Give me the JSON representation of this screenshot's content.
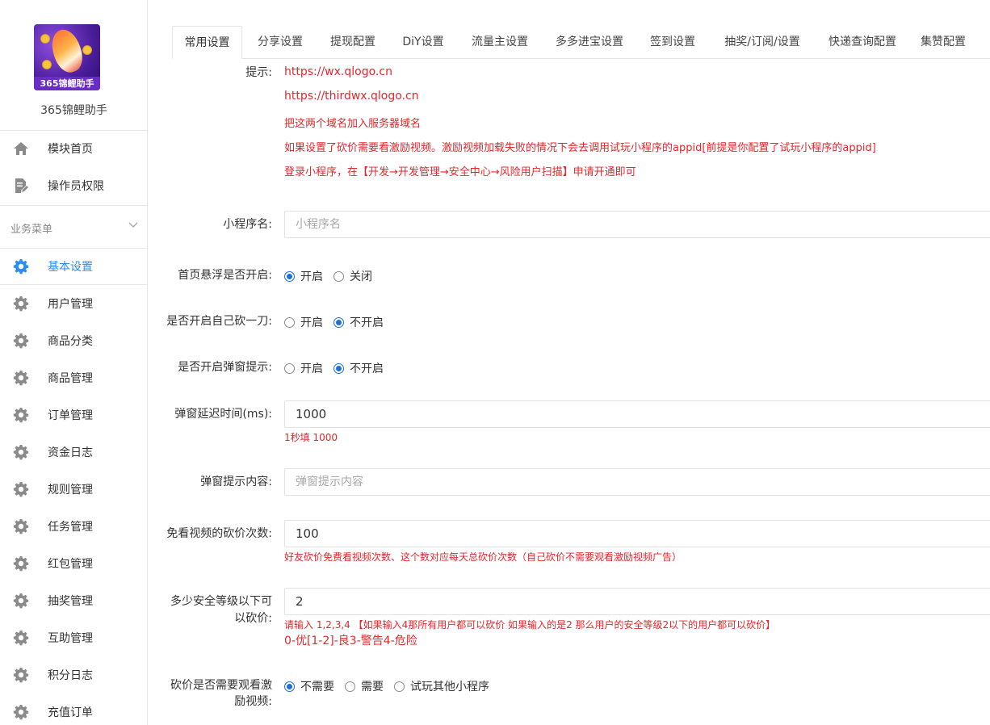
{
  "app": {
    "name": "365锦鲤助手",
    "logo_text": "365锦鲤助手"
  },
  "sidebar": {
    "top_items": [
      {
        "label": "模块首页",
        "icon": "home-icon"
      },
      {
        "label": "操作员权限",
        "icon": "document-edit-icon"
      }
    ],
    "section_title": "业务菜单",
    "items": [
      {
        "label": "基本设置",
        "icon": "gear-icon",
        "active": true
      },
      {
        "label": "用户管理",
        "icon": "gear-icon"
      },
      {
        "label": "商品分类",
        "icon": "gear-icon"
      },
      {
        "label": "商品管理",
        "icon": "gear-icon"
      },
      {
        "label": "订单管理",
        "icon": "gear-icon"
      },
      {
        "label": "资金日志",
        "icon": "gear-icon"
      },
      {
        "label": "规则管理",
        "icon": "gear-icon"
      },
      {
        "label": "任务管理",
        "icon": "gear-icon"
      },
      {
        "label": "红包管理",
        "icon": "gear-icon"
      },
      {
        "label": "抽奖管理",
        "icon": "gear-icon"
      },
      {
        "label": "互助管理",
        "icon": "gear-icon"
      },
      {
        "label": "积分日志",
        "icon": "gear-icon"
      },
      {
        "label": "充值订单",
        "icon": "gear-icon"
      }
    ]
  },
  "tabs": [
    "常用设置",
    "分享设置",
    "提现配置",
    "DiY设置",
    "流量主设置",
    "多多进宝设置",
    "签到设置",
    "抽奖/订阅/设置",
    "快递查询配置",
    "集赞配置"
  ],
  "form": {
    "tips_label": "提示:",
    "tips": [
      "https://wx.qlogo.cn",
      "https://thirdwx.qlogo.cn",
      "把这两个域名加入服务器域名",
      "如果设置了砍价需要看激励视频。激励视频加载失败的情况下会去调用试玩小程序的appid[前提是你配置了试玩小程序的appid]",
      "登录小程序，在【开发→开发管理→安全中心→风险用户扫描】申请开通即可"
    ],
    "mini_name": {
      "label": "小程序名:",
      "placeholder": "小程序名"
    },
    "float": {
      "label": "首页悬浮是否开启:",
      "opt_on": "开启",
      "opt_off": "关闭",
      "selected": "开启"
    },
    "self_cut": {
      "label": "是否开启自己砍一刀:",
      "opt_on": "开启",
      "opt_off": "不开启",
      "selected": "不开启"
    },
    "popup": {
      "label": "是否开启弹窗提示:",
      "opt_on": "开启",
      "opt_off": "不开启",
      "selected": "不开启"
    },
    "delay": {
      "label": "弹窗延迟时间(ms):",
      "value": "1000",
      "hint": "1秒填 1000"
    },
    "popup_content": {
      "label": "弹窗提示内容:",
      "placeholder": "弹窗提示内容"
    },
    "free_cut": {
      "label": "免看视频的砍价次数:",
      "value": "100",
      "hint": "好友砍价免费看视频次数、这个数对应每天总砍价次数（自己砍价不需要观看激励视频广告）"
    },
    "safety": {
      "label_line1": "多少安全等级以下可",
      "label_line2": "以砍价:",
      "value": "2",
      "hint1": "请输入 1,2,3,4 【如果输入4那所有用户都可以砍价 如果输入的是2 那么用户的安全等级2以下的用户都可以砍价】",
      "hint2": "0-优[1-2]-良3-警告4-危险"
    },
    "video": {
      "label_line1": "砍价是否需要观看激",
      "label_line2": "励视频:",
      "opt1": "不需要",
      "opt2": "需要",
      "opt3": "试玩其他小程序",
      "selected": "不需要"
    }
  },
  "colors": {
    "accent": "#2d8cf0",
    "hint_red": "#e5262b",
    "gear": "#8a8a8a"
  }
}
